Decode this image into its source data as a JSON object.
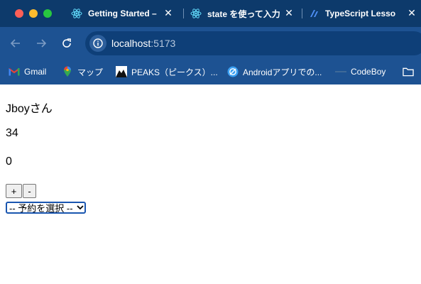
{
  "colors": {
    "tabstrip_bg": "#0d3a6b",
    "toolbar_bg": "#1d5292",
    "page_bg": "#ffffff",
    "select_focus": "#1a56b0"
  },
  "tabs": [
    {
      "title": "Getting Started –",
      "icon": "react-icon"
    },
    {
      "title": "state を使って入力",
      "icon": "react-icon"
    },
    {
      "title": "TypeScript Lesso",
      "icon": "typescript-icon"
    }
  ],
  "address_bar": {
    "host": "localhost",
    "port": ":5173"
  },
  "bookmarks": [
    {
      "label": "Gmail",
      "icon": "gmail-icon"
    },
    {
      "label": "マップ",
      "icon": "maps-icon"
    },
    {
      "label": "PEAKS（ピークス）...",
      "icon": "peaks-icon"
    },
    {
      "label": "Androidアプリでの...",
      "icon": "android-icon"
    },
    {
      "label": "CodeBoy",
      "icon": "codeboy-icon"
    },
    {
      "label": "",
      "icon": "folder-icon"
    }
  ],
  "content": {
    "name_text": "Jboyさん",
    "age_text": "34",
    "count_text": "0",
    "plus_label": "+",
    "minus_label": "-",
    "select_value": "-- 予約を選択 --"
  }
}
